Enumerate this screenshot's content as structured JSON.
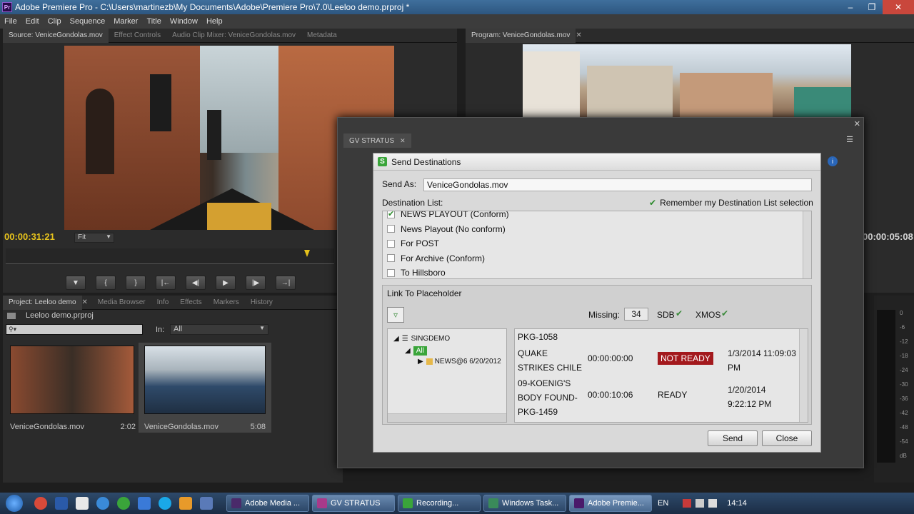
{
  "window": {
    "title": "Adobe Premiere Pro - C:\\Users\\martinezb\\My Documents\\Adobe\\Premiere Pro\\7.0\\Leeloo demo.prproj *",
    "app_badge": "Pr"
  },
  "menu": [
    "File",
    "Edit",
    "Clip",
    "Sequence",
    "Marker",
    "Title",
    "Window",
    "Help"
  ],
  "source_panel": {
    "tabs": [
      "Source: VeniceGondolas.mov",
      "Effect Controls",
      "Audio Clip Mixer: VeniceGondolas.mov",
      "Metadata"
    ],
    "timecode": "00:00:31:21",
    "fit": "Fit"
  },
  "program_panel": {
    "tab": "Program: VeniceGondolas.mov",
    "timecode": "00:00:05:08"
  },
  "project_panel": {
    "tabs": [
      "Project: Leeloo demo",
      "Media Browser",
      "Info",
      "Effects",
      "Markers",
      "History"
    ],
    "file": "Leeloo demo.prproj",
    "in_label": "In:",
    "in_value": "All",
    "items": [
      {
        "name": "VeniceGondolas.mov",
        "duration": "2:02"
      },
      {
        "name": "VeniceGondolas.mov",
        "duration": "5:08"
      }
    ]
  },
  "stratus_panel": {
    "tab": "GV STRATUS"
  },
  "dialog": {
    "title": "Send Destinations",
    "send_as_label": "Send As:",
    "send_as_value": "VeniceGondolas.mov",
    "dest_list_label": "Destination List:",
    "remember_label": "Remember my Destination List selection",
    "destinations": [
      {
        "label": "NEWS PLAYOUT (Conform)",
        "checked": true
      },
      {
        "label": "News Playout (No conform)",
        "checked": false
      },
      {
        "label": "For POST",
        "checked": false
      },
      {
        "label": "For Archive (Conform)",
        "checked": false
      },
      {
        "label": "To Hillsboro",
        "checked": false
      }
    ],
    "link_label": "Link To Placeholder",
    "missing_label": "Missing:",
    "missing_value": "34",
    "sdb_label": "SDB",
    "xmos_label": "XMOS",
    "tree": {
      "root": "SINGDEMO",
      "all": "All",
      "child": "NEWS@6 6/20/2012"
    },
    "rows": [
      {
        "title": "PKG-1058",
        "duration": "",
        "status": "",
        "date": ""
      },
      {
        "title": "QUAKE STRIKES CHILE",
        "duration": "00:00:00:00",
        "status": "NOT READY",
        "date": "1/3/2014 11:09:03 PM"
      },
      {
        "title": "09-KOENIG'S BODY FOUND- PKG-1459",
        "duration": "00:00:10:06",
        "status": "READY",
        "date": "1/20/2014 9:22:12 PM"
      }
    ],
    "send_button": "Send",
    "close_button": "Close"
  },
  "taskbar": {
    "items": [
      "Adobe Media ...",
      "GV STRATUS",
      "Recording...",
      "Windows Task...",
      "Adobe Premie..."
    ],
    "lang": "EN",
    "time": "14:14"
  },
  "meter_scale": [
    "0",
    "-6",
    "-12",
    "-18",
    "-24",
    "-30",
    "-36",
    "-42",
    "-48",
    "-54",
    "dB"
  ],
  "colors": {
    "timecode": "#e6c21c",
    "not_ready": "#a3191d",
    "gv_green": "#3aa53a"
  }
}
